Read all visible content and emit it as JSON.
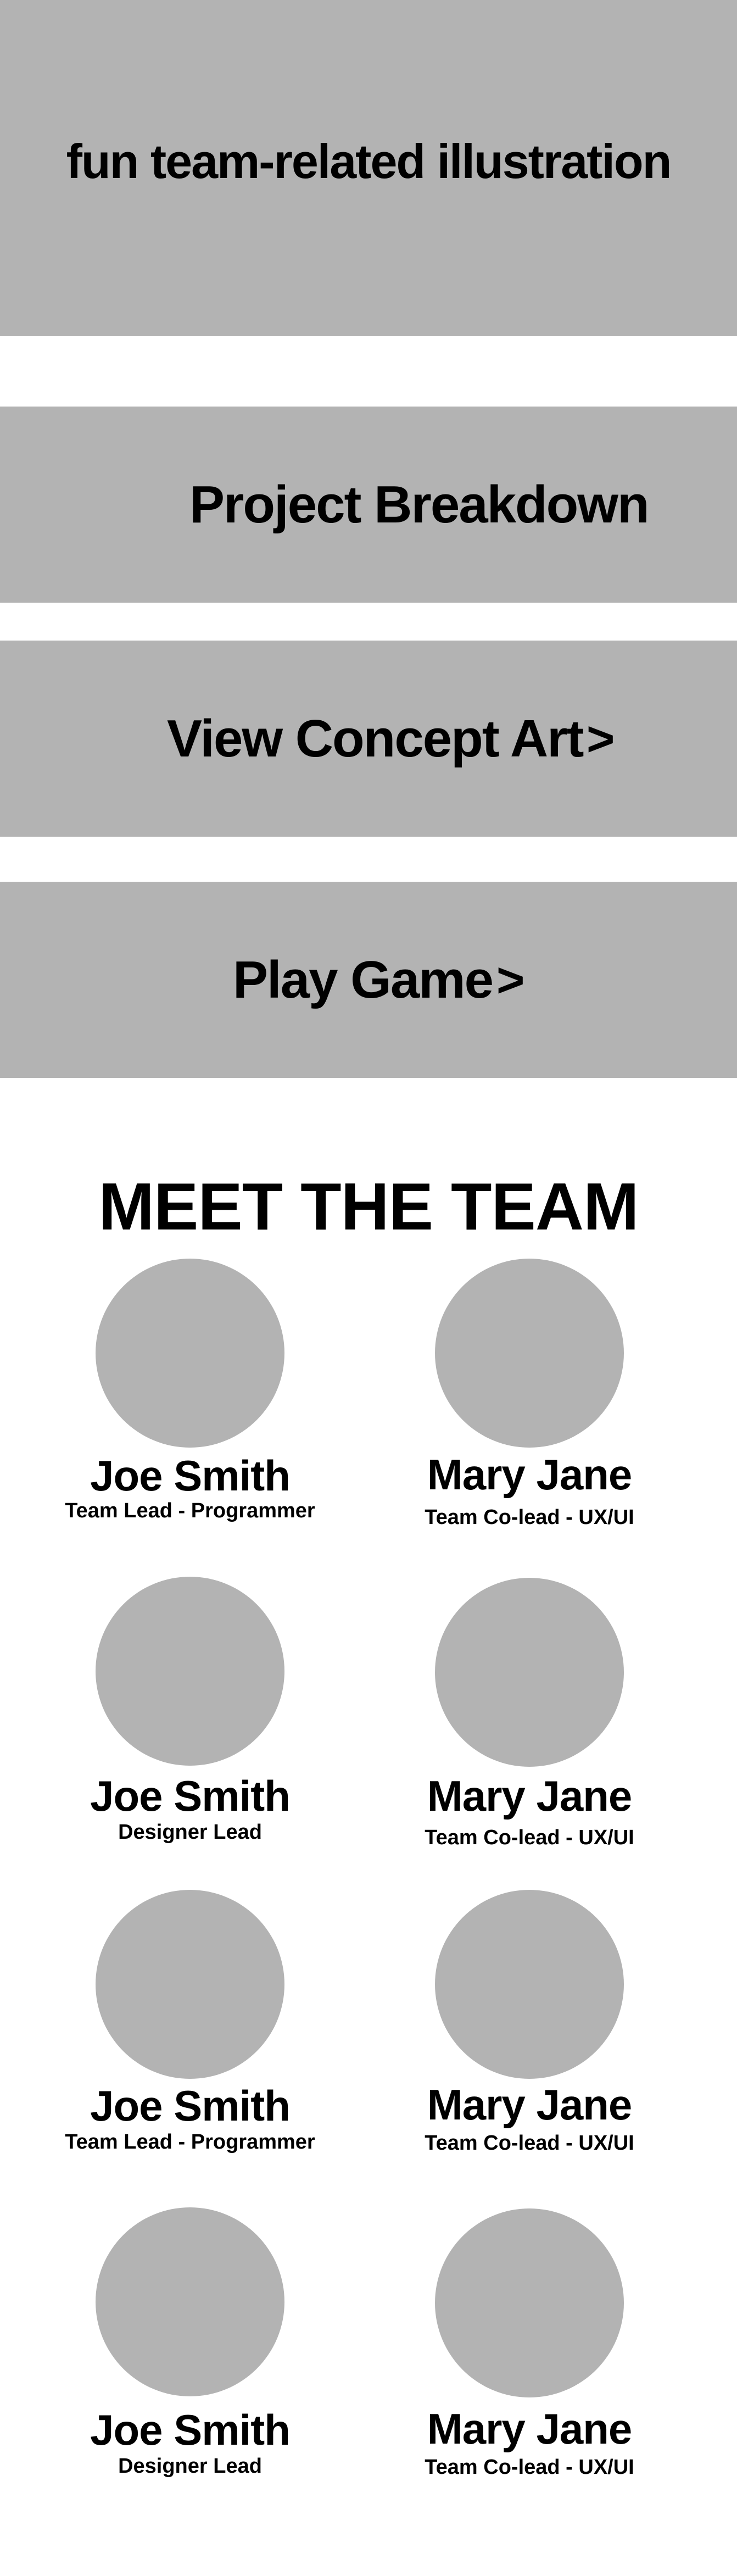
{
  "hero": {
    "text": "fun team-related illustration"
  },
  "nav": {
    "breakdown": {
      "label": "Project Breakdown"
    },
    "concept": {
      "label": "View Concept Art",
      "arrow": ">"
    },
    "play": {
      "label": "Play Game",
      "arrow": ">"
    }
  },
  "team": {
    "heading": "MEET THE TEAM",
    "members": [
      {
        "name": "Joe Smith",
        "role": "Team Lead - Programmer"
      },
      {
        "name": "Mary Jane",
        "role": "Team Co-lead - UX/UI"
      },
      {
        "name": "Joe Smith",
        "role": "Designer Lead"
      },
      {
        "name": "Mary Jane",
        "role": "Team Co-lead - UX/UI"
      },
      {
        "name": "Joe Smith",
        "role": "Team Lead - Programmer"
      },
      {
        "name": "Mary Jane",
        "role": "Team Co-lead - UX/UI"
      },
      {
        "name": "Joe Smith",
        "role": "Designer Lead"
      },
      {
        "name": "Mary Jane",
        "role": "Team Co-lead - UX/UI"
      }
    ]
  },
  "colors": {
    "placeholder": "#b3b3b3",
    "text": "#000000",
    "background": "#ffffff"
  }
}
